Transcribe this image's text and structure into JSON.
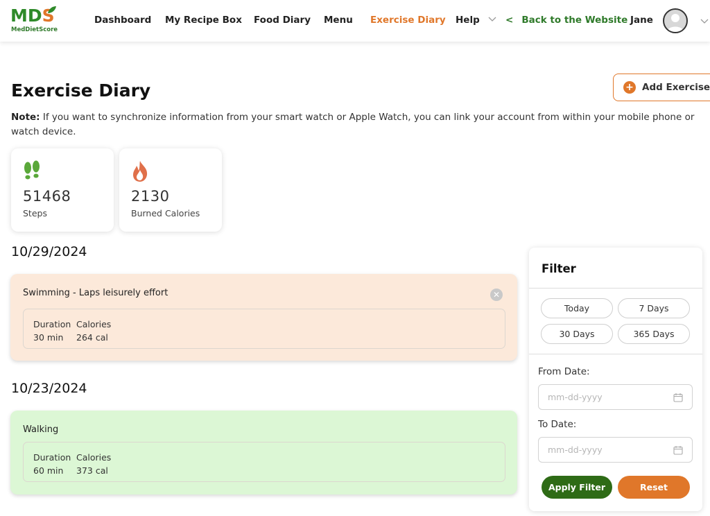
{
  "logo": {
    "mark_main": "MD",
    "mark_accent": "S",
    "subtitle": "MedDietScore"
  },
  "nav": {
    "items": [
      {
        "label": "Dashboard"
      },
      {
        "label": "My Recipe Box"
      },
      {
        "label": "Food Diary"
      },
      {
        "label": "Menu"
      },
      {
        "label": "Exercise Diary",
        "active": true
      },
      {
        "label": "Help"
      }
    ],
    "back_arrow": "<",
    "back_label": "Back to the Website",
    "user_name": "Jane"
  },
  "page": {
    "title": "Exercise Diary",
    "add_button": "Add Exercise",
    "note_label": "Note:",
    "note_text": " If you want to synchronize information from your smart watch or Apple Watch, you can link your account from within your mobile phone or watch device."
  },
  "stats": [
    {
      "icon": "footsteps-icon",
      "value": "51468",
      "label": "Steps"
    },
    {
      "icon": "flame-icon",
      "value": "2130",
      "label": "Burned Calories"
    }
  ],
  "entries": [
    {
      "date": "10/29/2024",
      "title": "Swimming - Laps leisurely effort",
      "duration_header": "Duration",
      "duration": "30 min",
      "calories_header": "Calories",
      "calories": "264 cal",
      "closable": true,
      "background": "#fce9da"
    },
    {
      "date": "10/23/2024",
      "title": "Walking",
      "duration_header": "Duration",
      "duration": "60 min",
      "calories_header": "Calories",
      "calories": "373 cal",
      "closable": false,
      "background": "#dcf7d5"
    }
  ],
  "filter": {
    "title": "Filter",
    "quick_ranges": [
      "Today",
      "7 Days",
      "30 Days",
      "365 Days"
    ],
    "from_label": "From Date:",
    "from_placeholder": "mm-dd-yyyy",
    "to_label": "To Date:",
    "to_placeholder": "mm-dd-yyyy",
    "apply_label": "Apply Filter",
    "reset_label": "Reset"
  },
  "colors": {
    "brand_green": "#2f8a2a",
    "accent_orange": "#e0772a",
    "apply_green": "#2e6b16"
  }
}
